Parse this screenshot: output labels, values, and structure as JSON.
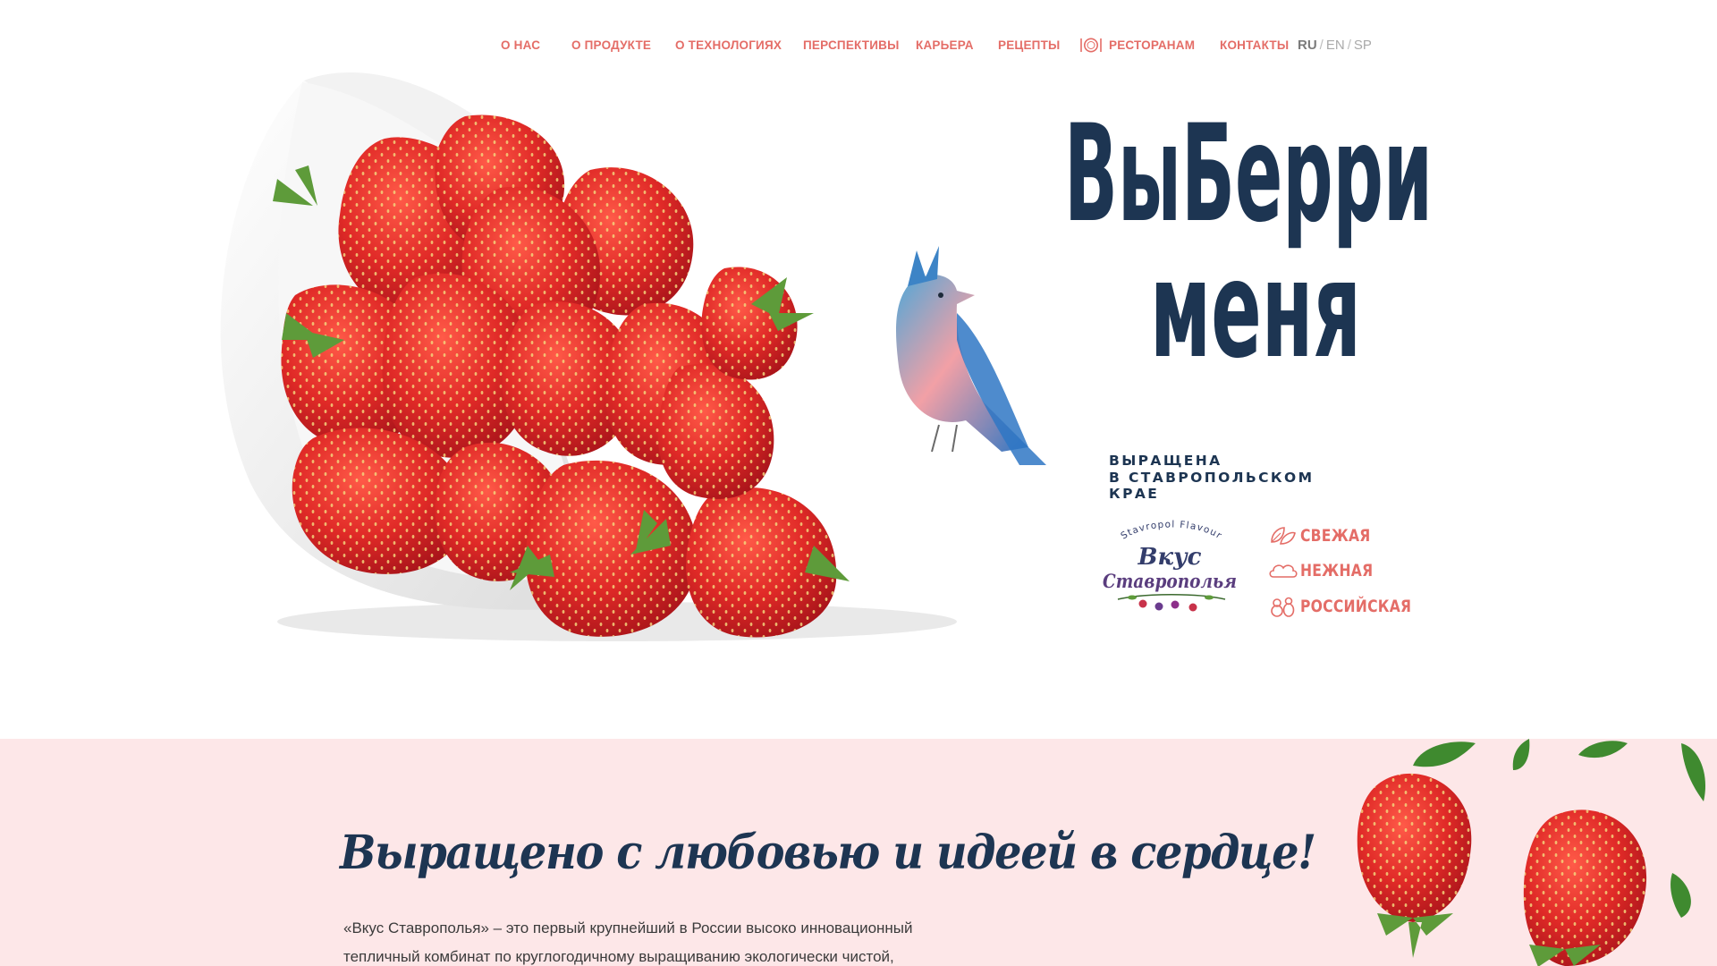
{
  "nav": {
    "items": [
      "О НАС",
      "О ПРОДУКТЕ",
      "О ТЕХНОЛОГИЯХ",
      "ПЕРСПЕКТИВЫ",
      "КАРЬЕРА",
      "РЕЦЕПТЫ",
      "РЕСТОРАНАМ",
      "КОНТАКТЫ"
    ],
    "languages": {
      "active": "RU",
      "others": [
        "EN",
        "SP"
      ],
      "separator": "/"
    }
  },
  "hero": {
    "headline_line1": "ВыБерри",
    "headline_line2": "меня",
    "grown_lines": [
      "ВЫРАЩЕНА",
      "В СТАВРОПОЛЬСКОМ",
      "КРАЕ"
    ],
    "logo": {
      "top_text": "Stavropol Flavour",
      "line1": "Вкус",
      "line2": "Ставрополья"
    },
    "features": [
      {
        "label": "СВЕЖАЯ",
        "icon": "leaf-icon"
      },
      {
        "label": "НЕЖНАЯ",
        "icon": "cloud-icon"
      },
      {
        "label": "РОССИЙСКАЯ",
        "icon": "matryoshka-icon"
      }
    ]
  },
  "about": {
    "title": "Выращено с любовью и идеей в сердце!",
    "text_line1": "«Вкус Ставрополья» – это первый крупнейший в России высоко инновационный",
    "text_line2": "тепличный комбинат по круглогодичному выращиванию экологически чистой,"
  },
  "colors": {
    "accent": "#e46d67",
    "navy": "#1d3552",
    "section_bg": "#fde7e8",
    "strawberry": "#e02a27",
    "lang_active": "#7b7b7b",
    "lang_inactive": "#a9a9a9"
  }
}
